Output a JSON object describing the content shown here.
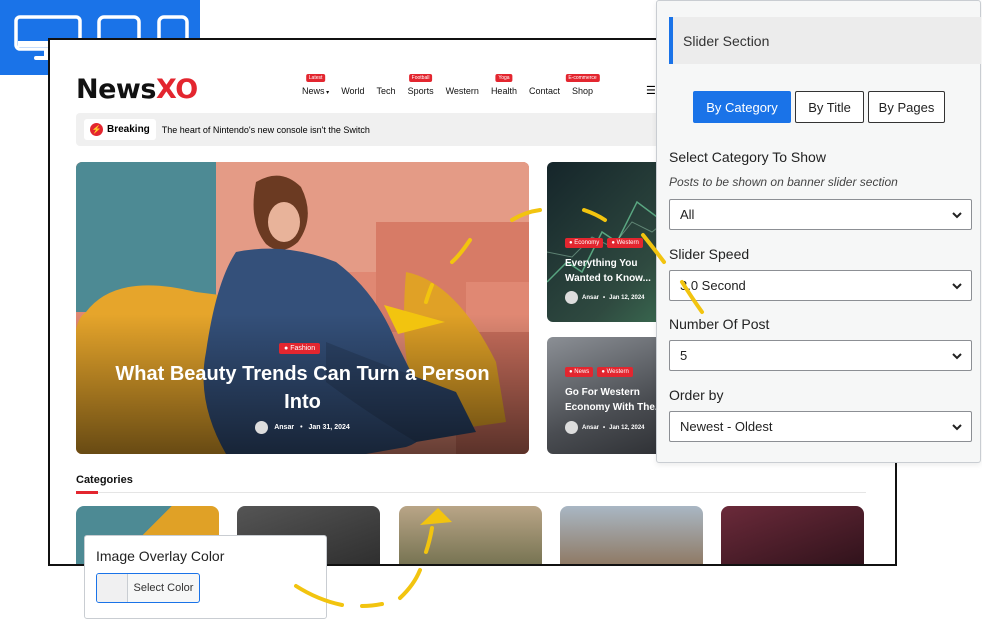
{
  "device_switcher": {
    "accent": "#1a73e8",
    "devices": [
      "desktop-icon",
      "tablet-icon",
      "mobile-icon"
    ]
  },
  "site": {
    "logo_text": "News",
    "logo_mark": "XO",
    "nav": [
      {
        "label": "News",
        "badge": "Latest",
        "dropdown": true
      },
      {
        "label": "World",
        "badge": ""
      },
      {
        "label": "Tech",
        "badge": ""
      },
      {
        "label": "Sports",
        "badge": "Football"
      },
      {
        "label": "Western",
        "badge": ""
      },
      {
        "label": "Health",
        "badge": "Yoga"
      },
      {
        "label": "Contact",
        "badge": ""
      },
      {
        "label": "Shop",
        "badge": "E-commerce"
      }
    ],
    "breaking": {
      "label": "Breaking",
      "headline": "The heart of Nintendo's new console isn't the Switch"
    },
    "hero": {
      "tag": "Fashion",
      "title": "What Beauty Trends Can Turn a Person Into",
      "author": "Ansar",
      "date": "Jan 31, 2024"
    },
    "side_posts": [
      {
        "tags": [
          "Economy",
          "Western"
        ],
        "title": "Everything You Wanted to Know...",
        "author": "Ansar",
        "date": "Jan 12, 2024"
      },
      {
        "tags": [
          "News",
          "Western"
        ],
        "title": "Go For Western Economy With The...",
        "author": "Ansar",
        "date": "Jan 12, 2024"
      }
    ],
    "categories_heading": "Categories",
    "accent": "#e3262f"
  },
  "panel": {
    "title": "Slider Section",
    "modes": [
      "By Category",
      "By Title",
      "By Pages"
    ],
    "active_mode": "By Category",
    "fields": {
      "category": {
        "label": "Select Category To Show",
        "hint": "Posts to be shown on banner slider section",
        "value": "All"
      },
      "speed": {
        "label": "Slider Speed",
        "value": "3.0 Second"
      },
      "count": {
        "label": "Number Of Post",
        "value": "5"
      },
      "order": {
        "label": "Order by",
        "value": "Newest - Oldest"
      }
    }
  },
  "overlay_color": {
    "label": "Image Overlay Color",
    "button": "Select Color"
  }
}
